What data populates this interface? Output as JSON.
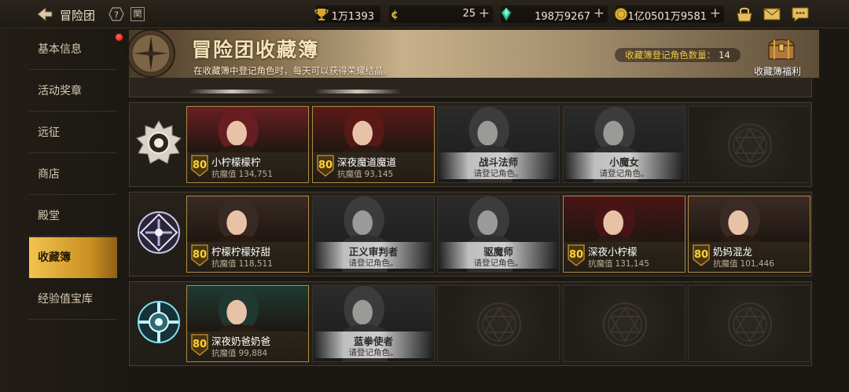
{
  "topbar": {
    "title": "冒险团",
    "help_icon": "question-icon",
    "kin_label": "関",
    "trophy": "1万1393",
    "coin": "25",
    "gem": "198万9267",
    "gold": "1亿0501万9581"
  },
  "sidebar": {
    "items": [
      {
        "label": "基本信息"
      },
      {
        "label": "活动奖章"
      },
      {
        "label": "远征"
      },
      {
        "label": "商店"
      },
      {
        "label": "殿堂"
      },
      {
        "label": "收藏簿"
      },
      {
        "label": "经验值宝库"
      }
    ],
    "active_index": 5
  },
  "banner": {
    "title": "冒险团收藏簿",
    "subtitle": "在收藏簿中登记角色时，每天可以获得荣耀结晶。",
    "count_label": "收藏簿登记角色数量：",
    "count_value": "14",
    "benefit_label": "收藏簿福利"
  },
  "stat_label": "抗魔值",
  "rows": [
    {
      "emblem": "white-sun-emblem",
      "cards": [
        {
          "state": "filled",
          "level": "80",
          "name": "小柠檬檬柠",
          "stat": "134,751",
          "tone": "#6a1e22"
        },
        {
          "state": "filled",
          "level": "80",
          "name": "深夜魔道魔道",
          "stat": "93,145",
          "tone": "#5b1a17"
        },
        {
          "state": "locked",
          "name": "战斗法师",
          "hint": "请登记角色。"
        },
        {
          "state": "locked",
          "name": "小魔女",
          "hint": "请登记角色。"
        },
        {
          "state": "empty"
        }
      ]
    },
    {
      "emblem": "purple-cross-emblem",
      "cards": [
        {
          "state": "filled",
          "level": "80",
          "name": "柠檬柠檬好甜",
          "stat": "118,511",
          "tone": "#3a2a24"
        },
        {
          "state": "locked",
          "name": "正义审判者",
          "hint": "请登记角色。"
        },
        {
          "state": "locked",
          "name": "驱魔师",
          "hint": "请登记角色。"
        },
        {
          "state": "filled",
          "level": "80",
          "name": "深夜小柠檬",
          "stat": "131,145",
          "tone": "#4a1416"
        },
        {
          "state": "filled",
          "level": "80",
          "name": "奶妈混龙",
          "stat": "101,446",
          "tone": "#3c2b26"
        }
      ]
    },
    {
      "emblem": "cyan-cross-emblem",
      "cards": [
        {
          "state": "filled",
          "level": "80",
          "name": "深夜奶爸奶爸",
          "stat": "99,884",
          "tone": "#1f3a33"
        },
        {
          "state": "locked",
          "name": "蓝拳使者",
          "hint": "请登记角色。"
        },
        {
          "state": "empty"
        },
        {
          "state": "empty"
        },
        {
          "state": "empty"
        }
      ]
    }
  ]
}
